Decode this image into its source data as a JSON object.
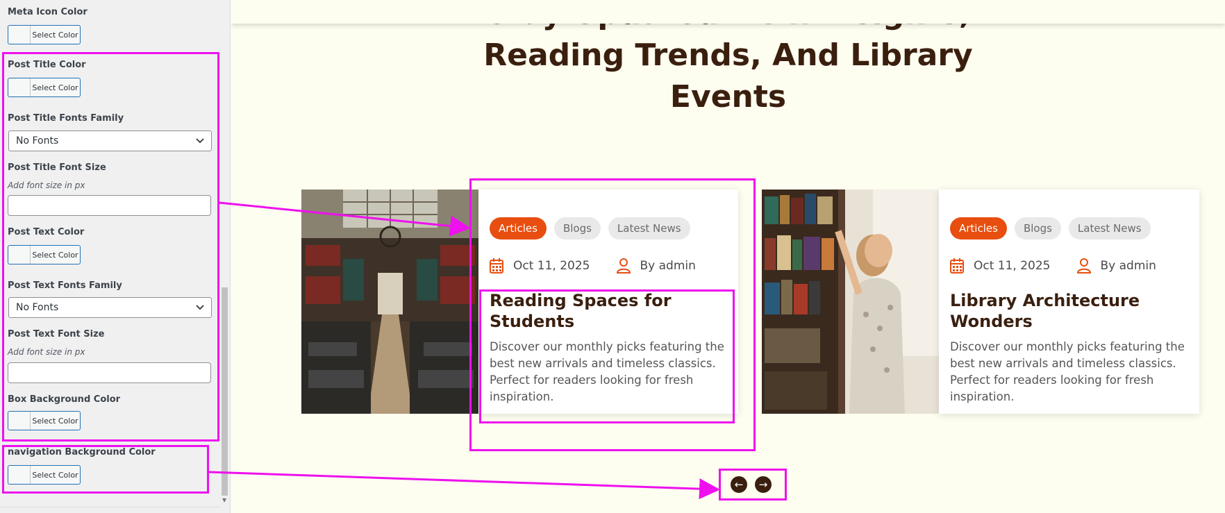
{
  "customizer": {
    "meta_icon_color": {
      "label": "Meta Icon Color",
      "button": "Select Color"
    },
    "post_title_color": {
      "label": "Post Title Color",
      "button": "Select Color"
    },
    "post_title_fonts_family": {
      "label": "Post Title Fonts Family",
      "value": "No Fonts"
    },
    "post_title_font_size": {
      "label": "Post Title Font Size",
      "hint": "Add font size in px",
      "value": ""
    },
    "post_text_color": {
      "label": "Post Text Color",
      "button": "Select Color"
    },
    "post_text_fonts_family": {
      "label": "Post Text Fonts Family",
      "value": "No Fonts"
    },
    "post_text_font_size": {
      "label": "Post Text Font Size",
      "hint": "Add font size in px",
      "value": ""
    },
    "box_background_color": {
      "label": "Box Background Color",
      "button": "Select Color"
    },
    "navigation_background_color": {
      "label": "navigation Background Color",
      "button": "Select Color"
    }
  },
  "preview": {
    "heading_lines": [
      "Stay Updated With Insights,",
      "Reading Trends, And Library",
      "Events"
    ],
    "posts": [
      {
        "tags": [
          "Articles",
          "Blogs",
          "Latest News"
        ],
        "date": "Oct 11, 2025",
        "author": "By admin",
        "title": "Reading Spaces for Students",
        "text": "Discover our monthly picks featuring the best new arrivals and timeless classics. Perfect for readers looking for fresh inspiration."
      },
      {
        "tags": [
          "Articles",
          "Blogs",
          "Latest News"
        ],
        "date": "Oct 11, 2025",
        "author": "By admin",
        "title": "Library Architecture Wonders",
        "text": "Discover our monthly picks featuring the best new arrivals and timeless classics. Perfect for readers looking for fresh inspiration."
      }
    ],
    "nav": {
      "prev_icon": "←",
      "next_icon": "→"
    }
  },
  "icons": {
    "calendar": "calendar-icon",
    "user": "user-icon",
    "chevron": "chevron-down-icon",
    "prev": "arrow-left-icon",
    "next": "arrow-right-icon"
  },
  "colors": {
    "accent": "#e84e0f",
    "heading": "#3a1f0f",
    "annotation": "#ee10ee",
    "page_bg": "#fdfdf0",
    "panel_bg": "#f0f0f1",
    "button_border": "#2271b1"
  }
}
